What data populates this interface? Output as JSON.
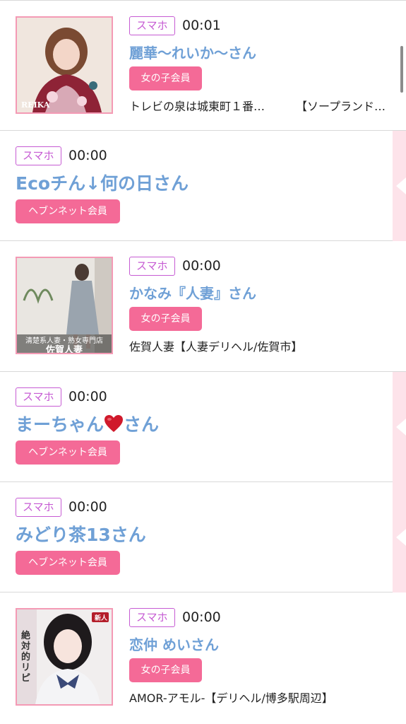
{
  "colors": {
    "accent_blue": "#6fa0d6",
    "member_pink": "#f46a97",
    "device_purple": "#c65bd3",
    "side_pink": "#fde3ea"
  },
  "entries": [
    {
      "device": "スマホ",
      "time": "00:01",
      "name": "麗華～れいか～さん",
      "member": "女の子会員",
      "shop_left": "トレビの泉は城東町１番…",
      "shop_right": "【ソープランド…",
      "photo_caption": "REIKA"
    },
    {
      "device": "スマホ",
      "time": "00:00",
      "name": "Ecoチん↓何の日さん",
      "member": "ヘブンネット会員"
    },
    {
      "device": "スマホ",
      "time": "00:00",
      "name": "かなみ『人妻』さん",
      "member": "女の子会員",
      "shop": "佐賀人妻【人妻デリヘル/佐賀市】",
      "photo_caption_top": "清楚系人妻・熟女専門店",
      "photo_caption_bottom": "佐賀人妻"
    },
    {
      "device": "スマホ",
      "time": "00:00",
      "name_before": "まーちゃん",
      "name_after": "さん",
      "member": "ヘブンネット会員"
    },
    {
      "device": "スマホ",
      "time": "00:00",
      "name": "みどり茶13さん",
      "member": "ヘブンネット会員"
    },
    {
      "device": "スマホ",
      "time": "00:00",
      "name": "恋仲 めいさん",
      "member": "女の子会員",
      "shop": "AMOR-アモル-【デリヘル/博多駅周辺】",
      "photo_caption": "絶対的リピ",
      "photo_tag": "新人"
    }
  ]
}
